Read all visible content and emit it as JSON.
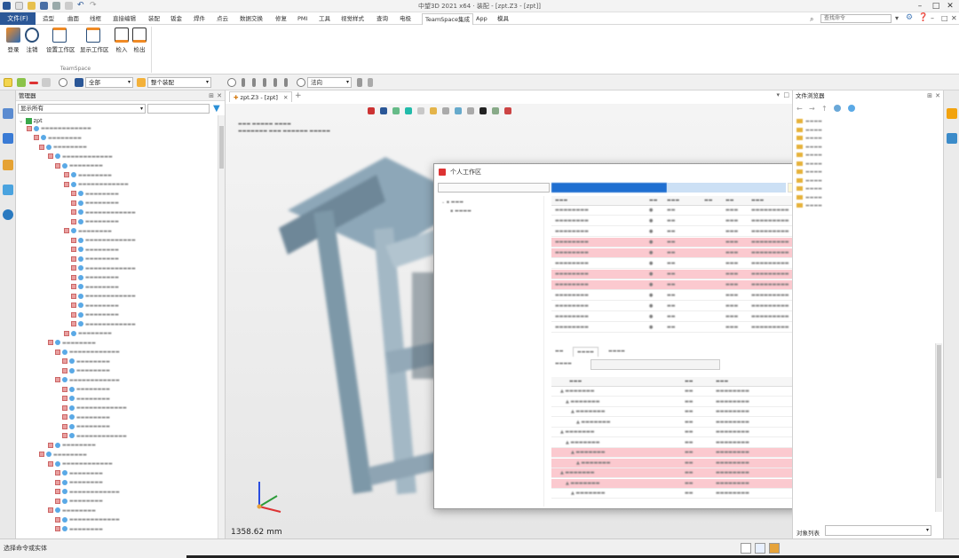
{
  "window": {
    "title": "中望3D 2021 x64 · 装配 - [zpt.Z3 - [zpt]]"
  },
  "menu": {
    "file": "文件(F)",
    "tabs": [
      "造型",
      "曲面",
      "线框",
      "直接编辑",
      "装配",
      "钣金",
      "焊件",
      "点云",
      "数据交换",
      "修复",
      "PMI",
      "工具",
      "视觉样式",
      "查询",
      "电极",
      "TeamSpace集成",
      "App",
      "模具"
    ],
    "active": "TeamSpace集成",
    "search_placeholder": "查找命令"
  },
  "ribbon": {
    "buttons": [
      "登录",
      "注销",
      "设置工作区",
      "显示工作区",
      "检入",
      "检出"
    ],
    "group": "TeamSpace"
  },
  "toolbar": {
    "filter_all": "全部",
    "assembly_scope": "整个装配",
    "direction": "法向"
  },
  "manager": {
    "title": "管理器",
    "filter": "显示所有",
    "root": "zpt"
  },
  "document": {
    "tab": "zpt.Z3 - [zpt]",
    "dimension": "1358.62 mm"
  },
  "file_browser": {
    "title": "文件浏览器"
  },
  "dialog": {
    "title": "个人工作区"
  },
  "object_list": {
    "label": "对象列表"
  },
  "status": {
    "prompt": "选择命令或实体"
  }
}
